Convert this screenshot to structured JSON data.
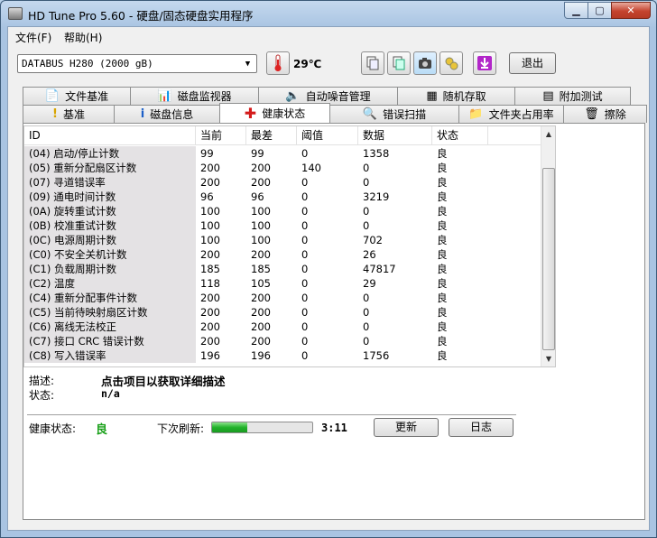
{
  "window": {
    "title": "HD Tune Pro 5.60 - 硬盘/固态硬盘实用程序"
  },
  "menu": [
    {
      "label": "文件(F)"
    },
    {
      "label": "帮助(H)"
    }
  ],
  "toolbar": {
    "drive": "DATABUS  H280 (2000 gB)",
    "temperature": "29℃",
    "exit_label": "退出"
  },
  "tabs_row1": [
    {
      "label": "文件基准",
      "icon": "document-icon"
    },
    {
      "label": "磁盘监视器",
      "icon": "monitor-chart-icon"
    },
    {
      "label": "自动噪音管理",
      "icon": "speaker-icon"
    },
    {
      "label": "随机存取",
      "icon": "random-access-icon"
    },
    {
      "label": "附加测试",
      "icon": "extra-tests-icon"
    }
  ],
  "tabs_row2": [
    {
      "label": "基准",
      "icon": "exclamation-icon"
    },
    {
      "label": "磁盘信息",
      "icon": "info-icon"
    },
    {
      "label": "健康状态",
      "icon": "red-cross-icon",
      "active": true
    },
    {
      "label": "错误扫描",
      "icon": "magnifier-icon"
    },
    {
      "label": "文件夹占用率",
      "icon": "folder-icon"
    },
    {
      "label": "擦除",
      "icon": "trash-icon"
    }
  ],
  "table": {
    "headers": [
      "ID",
      "当前",
      "最差",
      "阈值",
      "数据",
      "状态"
    ],
    "rows": [
      [
        "(04) 启动/停止计数",
        "99",
        "99",
        "0",
        "1358",
        "良"
      ],
      [
        "(05) 重新分配扇区计数",
        "200",
        "200",
        "140",
        "0",
        "良"
      ],
      [
        "(07) 寻道错误率",
        "200",
        "200",
        "0",
        "0",
        "良"
      ],
      [
        "(09) 通电时间计数",
        "96",
        "96",
        "0",
        "3219",
        "良"
      ],
      [
        "(0A) 旋转重试计数",
        "100",
        "100",
        "0",
        "0",
        "良"
      ],
      [
        "(0B) 校准重试计数",
        "100",
        "100",
        "0",
        "0",
        "良"
      ],
      [
        "(0C) 电源周期计数",
        "100",
        "100",
        "0",
        "702",
        "良"
      ],
      [
        "(C0) 不安全关机计数",
        "200",
        "200",
        "0",
        "26",
        "良"
      ],
      [
        "(C1) 负载周期计数",
        "185",
        "185",
        "0",
        "47817",
        "良"
      ],
      [
        "(C2) 温度",
        "118",
        "105",
        "0",
        "29",
        "良"
      ],
      [
        "(C4) 重新分配事件计数",
        "200",
        "200",
        "0",
        "0",
        "良"
      ],
      [
        "(C5) 当前待映射扇区计数",
        "200",
        "200",
        "0",
        "0",
        "良"
      ],
      [
        "(C6) 离线无法校正",
        "200",
        "200",
        "0",
        "0",
        "良"
      ],
      [
        "(C7) 接口 CRC 错误计数",
        "200",
        "200",
        "0",
        "0",
        "良"
      ],
      [
        "(C8) 写入错误率",
        "196",
        "196",
        "0",
        "1756",
        "良"
      ]
    ]
  },
  "details": {
    "description_label": "描述:",
    "description_value": "点击项目以获取详细描述",
    "status_label": "状态:",
    "status_value": "n/a"
  },
  "footer": {
    "health_label": "健康状态:",
    "health_value": "良",
    "next_refresh_label": "下次刷新:",
    "refresh_progress": 0.35,
    "timer": "3:11",
    "update_label": "更新",
    "log_label": "日志"
  },
  "colors": {
    "health_good": "#19a019",
    "progress": "#22b22a"
  }
}
